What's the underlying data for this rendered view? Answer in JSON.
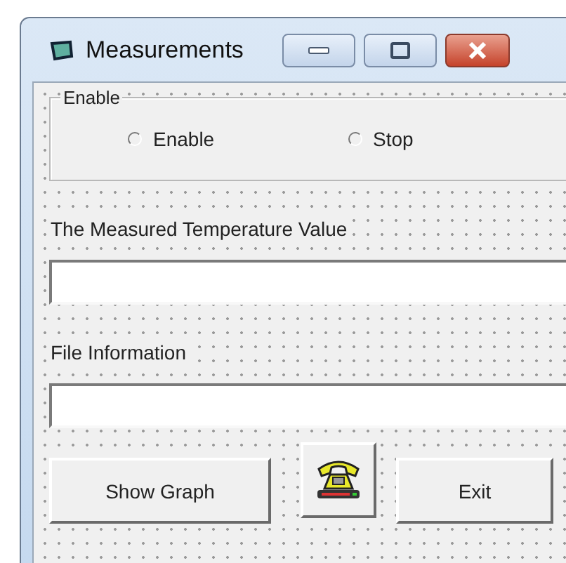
{
  "window": {
    "title": "Measurements"
  },
  "enable_frame": {
    "caption": "Enable",
    "options": [
      {
        "label": "Enable",
        "selected": false
      },
      {
        "label": "Stop",
        "selected": false
      }
    ]
  },
  "temperature": {
    "label": "The Measured Temperature Value"
  },
  "file_info": {
    "label": "File Information"
  },
  "buttons": [
    {
      "kind": "text",
      "label": "Show Graph"
    },
    {
      "kind": "icon"
    },
    {
      "kind": "text",
      "label": "Exit"
    }
  ]
}
